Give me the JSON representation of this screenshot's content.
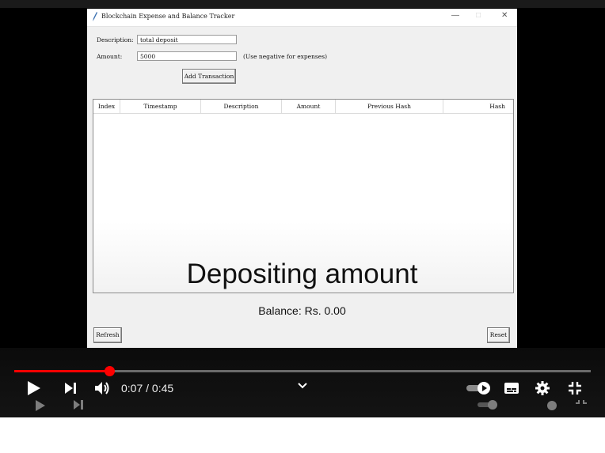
{
  "app_window": {
    "title": "Blockchain Expense and Balance Tracker",
    "description_label": "Description:",
    "description_value": "total deposit",
    "amount_label": "Amount:",
    "amount_value": "5000",
    "amount_hint": "(Use negative for expenses)",
    "add_button": "Add Transaction",
    "columns": [
      "Index",
      "Timestamp",
      "Description",
      "Amount",
      "Previous Hash",
      "Hash"
    ],
    "balance": "Balance: Rs. 0.00",
    "refresh_button": "Refresh",
    "reset_button": "Reset"
  },
  "caption": "Depositing amount",
  "player": {
    "current_time": "0:07",
    "duration": "0:45",
    "time_display": "0:07 / 0:45",
    "progress_fraction": 0.165,
    "accent_color": "#ff0000"
  },
  "icons": [
    "play-icon",
    "next-icon",
    "volume-icon",
    "chevron-down-icon",
    "autoplay-toggle-icon",
    "subtitles-icon",
    "settings-icon",
    "exit-fullscreen-icon"
  ]
}
